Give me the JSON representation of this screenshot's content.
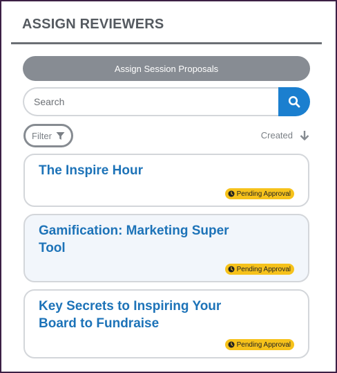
{
  "header": {
    "title": "ASSIGN REVIEWERS"
  },
  "assign_button": {
    "label": "Assign Session Proposals"
  },
  "search": {
    "placeholder": "Search",
    "value": ""
  },
  "filter": {
    "label": "Filter"
  },
  "sort": {
    "label": "Created",
    "direction": "descending"
  },
  "colors": {
    "accent": "#1b7fcf",
    "title_blue": "#1d73b8",
    "badge_yellow": "#f6c21b",
    "frame": "#3c1f45",
    "gray_button": "#878c93"
  },
  "proposals": [
    {
      "title": "The Inspire Hour",
      "status": "Pending Approval"
    },
    {
      "title": "Gamification: Marketing Super Tool",
      "status": "Pending Approval"
    },
    {
      "title": "Key Secrets to Inspiring Your Board to Fundraise",
      "status": "Pending Approval"
    }
  ]
}
